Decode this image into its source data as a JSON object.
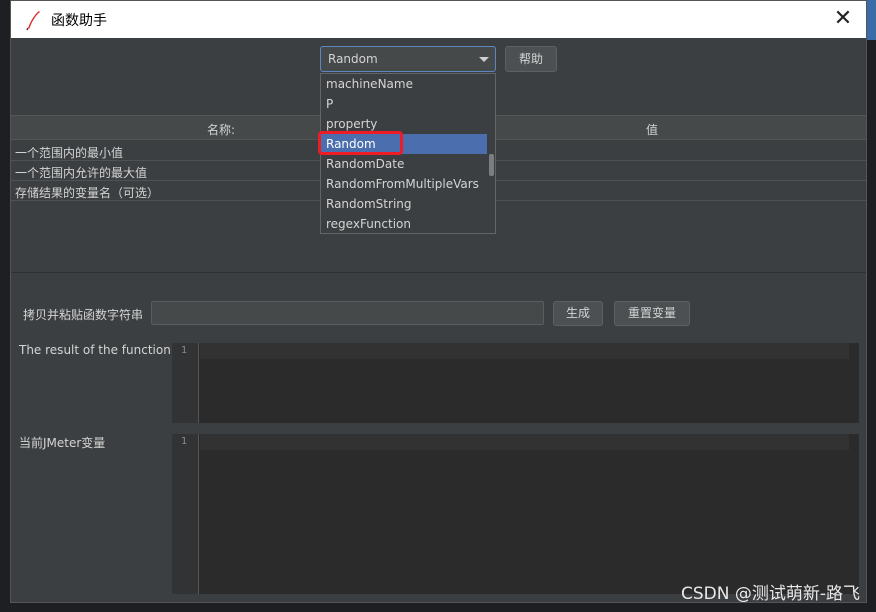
{
  "window": {
    "title": "函数助手"
  },
  "function_select": {
    "value": "Random"
  },
  "help_button": "帮助",
  "dropdown": {
    "items": [
      "machineName",
      "P",
      "property",
      "Random",
      "RandomDate",
      "RandomFromMultipleVars",
      "RandomString",
      "regexFunction"
    ],
    "selected_index": 3
  },
  "table": {
    "headers": {
      "name": "名称:",
      "value": "值"
    },
    "rows": [
      "一个范围内的最小值",
      "一个范围内允许的最大值",
      "存储结果的变量名（可选）"
    ]
  },
  "copy_paste": {
    "label": "拷贝并粘贴函数字符串",
    "value": ""
  },
  "buttons": {
    "generate": "生成",
    "reset": "重置变量"
  },
  "result": {
    "label": "The result of the function is",
    "line_number": "1"
  },
  "jmeter_vars": {
    "label": "当前JMeter变量",
    "line_number": "1"
  },
  "watermark": "CSDN @测试萌新-路飞",
  "colors": {
    "accent": "#4b6eaf",
    "highlight": "#ee1c25",
    "background": "#3c3f41"
  }
}
